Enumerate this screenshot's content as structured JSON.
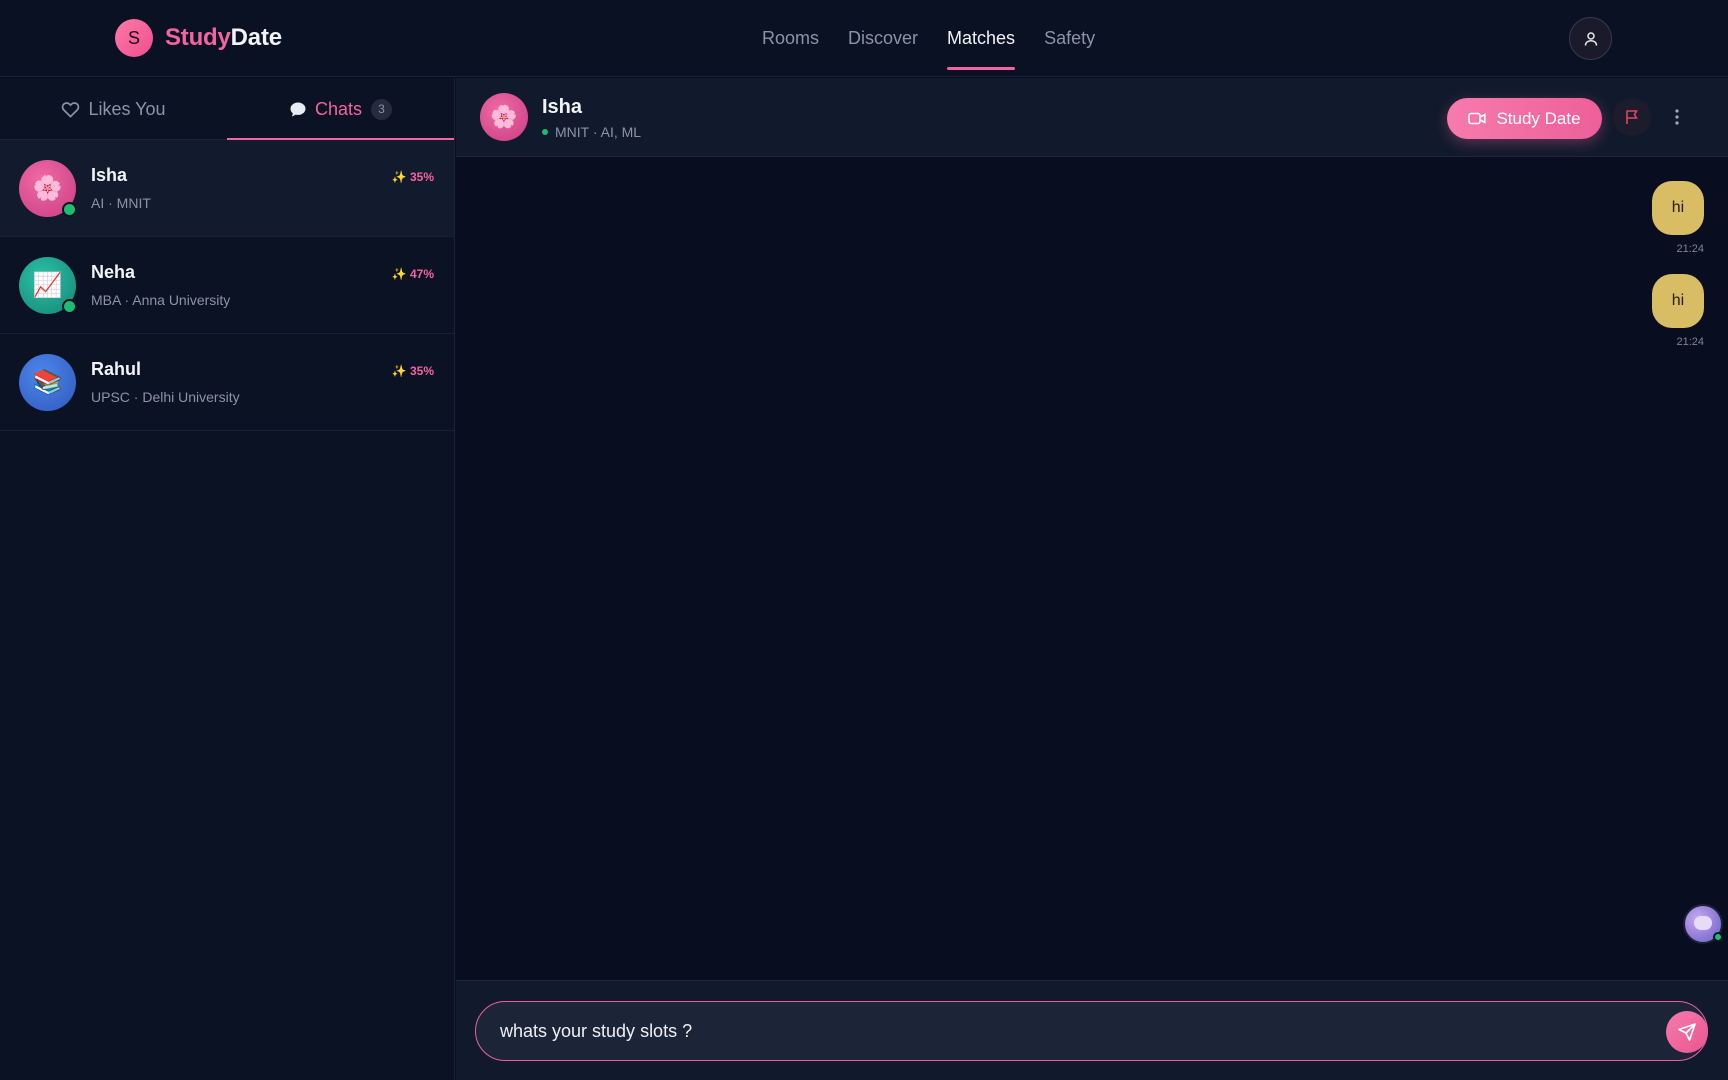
{
  "brand": {
    "logo_letter": "S",
    "name_part1": "Study",
    "name_part2": "Date",
    "accent": "#f4649f"
  },
  "nav": {
    "items": [
      {
        "label": "Rooms",
        "active": false
      },
      {
        "label": "Discover",
        "active": false
      },
      {
        "label": "Matches",
        "active": true
      },
      {
        "label": "Safety",
        "active": false
      }
    ],
    "profile_icon": "user-icon"
  },
  "sidebar": {
    "tabs": [
      {
        "label": "Likes You",
        "icon": "heart-icon",
        "active": false
      },
      {
        "label": "Chats",
        "icon": "speech-bubble-icon",
        "active": true,
        "count": "3"
      }
    ],
    "chats": [
      {
        "name": "Isha",
        "subtitle": "AI · MNIT",
        "score": "✨ 35%",
        "emoji": "🌸",
        "online": true,
        "selected": true,
        "avatar_color": "#d84d8f"
      },
      {
        "name": "Neha",
        "subtitle": "MBA · Anna University",
        "score": "✨ 47%",
        "emoji": "📈",
        "online": true,
        "selected": false,
        "avatar_color": "#1aa08c"
      },
      {
        "name": "Rahul",
        "subtitle": "UPSC · Delhi University",
        "score": "✨ 35%",
        "emoji": "📚",
        "online": false,
        "selected": false,
        "avatar_color": "#3a6fd6"
      }
    ]
  },
  "chat": {
    "header": {
      "name": "Isha",
      "status": "MNIT · AI, ML",
      "emoji": "🌸",
      "online": true
    },
    "actions": {
      "study_date_label": "Study Date",
      "report_icon": "flag-icon",
      "more_icon": "kebab-menu-icon"
    },
    "messages": [
      {
        "text": "hi",
        "time": "21:24",
        "outgoing": true
      },
      {
        "text": "hi",
        "time": "21:24",
        "outgoing": true
      }
    ],
    "composer": {
      "value": "whats your study slots ?",
      "send_icon": "send-icon"
    }
  }
}
